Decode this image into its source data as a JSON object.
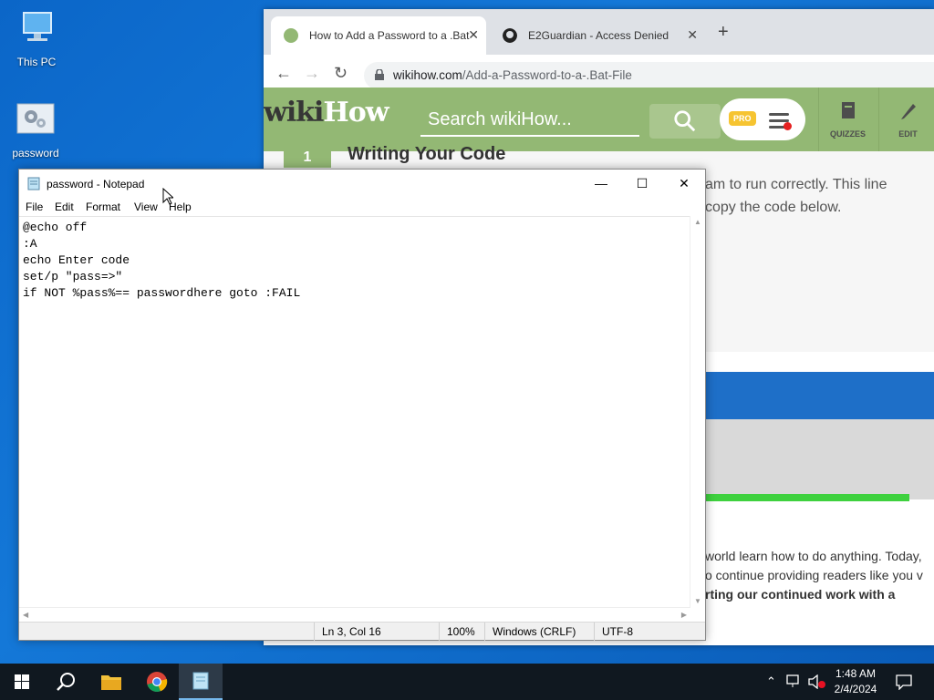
{
  "desktop": {
    "icons": [
      {
        "label": "This PC"
      },
      {
        "label": "password"
      }
    ]
  },
  "browser": {
    "tabs": [
      {
        "title": "How to Add a Password to a .Bat"
      },
      {
        "title": "E2Guardian - Access Denied"
      }
    ],
    "address": {
      "host": "wikihow.com",
      "path": "/Add-a-Password-to-a-.Bat-File"
    },
    "page": {
      "logo_wiki": "wiki",
      "logo_how": "How",
      "search_placeholder": "Search wikiHow...",
      "pro_badge": "PRO",
      "nav": [
        {
          "label": "QUIZZES"
        },
        {
          "label": "EDIT"
        }
      ],
      "step_number": "1",
      "step_title": "Writing Your Code",
      "text_line1": "am to run correctly. This line",
      "text_line2": "copy the code below.",
      "lower_line1": "world learn how to do anything. Today,",
      "lower_line2": "o continue providing readers like you v",
      "lower_line3": "rting our continued work with a"
    }
  },
  "notepad": {
    "title": "password - Notepad",
    "menu": [
      "File",
      "Edit",
      "Format",
      "View",
      "Help"
    ],
    "content": "@echo off\n:A\necho Enter code\nset/p \"pass=>\"\nif NOT %pass%== passwordhere goto :FAIL",
    "status": {
      "position": "Ln 3, Col 16",
      "zoom": "100%",
      "line_endings": "Windows (CRLF)",
      "encoding": "UTF-8"
    }
  },
  "taskbar": {
    "apps": [
      "start",
      "search",
      "file-explorer",
      "chrome",
      "notepad"
    ],
    "clock_time": "1:48 AM",
    "clock_date": "2/4/2024"
  },
  "colors": {
    "wikihow_green": "#93b874",
    "desktop_blue": "#0b66c8",
    "taskbar": "#101820"
  }
}
